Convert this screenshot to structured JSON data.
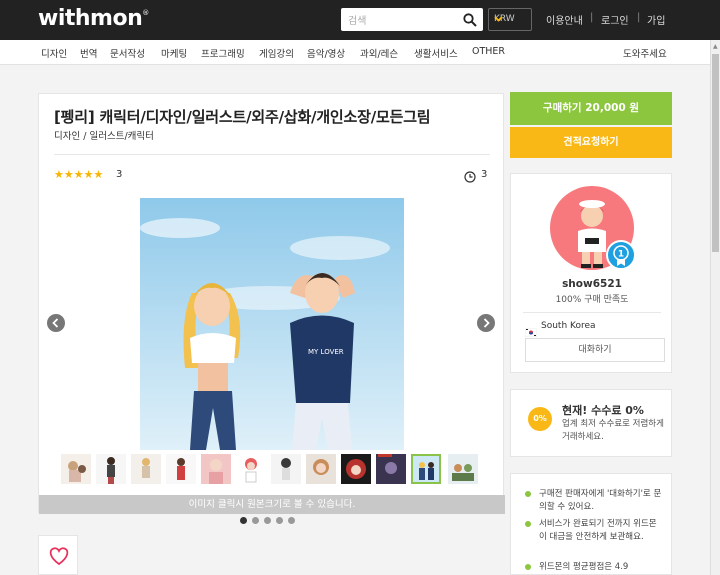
{
  "header": {
    "logo": "withmon",
    "logo_mark": "®",
    "search_placeholder": "검색",
    "currency": "KRW",
    "nav": [
      "이용안내",
      "로그인",
      "가입"
    ]
  },
  "categories": [
    "디자인",
    "번역",
    "문서작성",
    "마케팅",
    "프로그래밍",
    "게임강의",
    "음악/영상",
    "과외/레슨",
    "생활서비스",
    "OTHER"
  ],
  "help_link": "도와주세요",
  "product": {
    "title": "[펭리] 캐릭터/디자인/일러스트/외주/삽화/개인소장/모든그림",
    "breadcrumb": [
      "디자인",
      "일러스트/캐릭터"
    ],
    "breadcrumb_sep": "/",
    "rating_stars": 5,
    "rating_glyphs": "★★★★★",
    "review_count": "3",
    "delivery_days": "3",
    "image_caption": "이미지 클릭시 원본크기로 볼 수 있습니다.",
    "thumbnail_count": 12,
    "selected_thumbnail": 11,
    "page_dots": 5,
    "active_dot": 1,
    "hero_shirt_text": "MY LOVER"
  },
  "sidebar": {
    "buy_label": "구매하기 20,000 원",
    "quote_label": "견적요청하기",
    "seller": {
      "name": "show6521",
      "satisfaction": "100% 구매 만족도",
      "level": "1",
      "country": "South Korea",
      "chat_label": "대화하기"
    },
    "fee": {
      "icon_text": "0%",
      "title": "현재! 수수료 0%",
      "desc": "업계 최저 수수료로 저렴하게 거래하세요."
    },
    "tips": [
      "구매전 판매자에게 '대화하기'로 문의할 수 있어요.",
      "서비스가 완료되기 전까지 위드몬이 대금을 안전하게 보관해요.",
      "위드몬의 평균평점은 4.9"
    ]
  },
  "colors": {
    "topbar": "#222222",
    "buy_green": "#8cc63f",
    "quote_orange": "#f9b816",
    "star": "#f7b500",
    "avatar_bg": "#f7797d",
    "badge_blue": "#1fa0e0"
  },
  "icons": {
    "search": "search-icon",
    "currency_caret": "chevron-down-icon",
    "clock": "clock-icon",
    "prev": "chevron-left-icon",
    "next": "chevron-right-icon",
    "heart": "heart-icon",
    "flag": "korea-flag-icon"
  }
}
